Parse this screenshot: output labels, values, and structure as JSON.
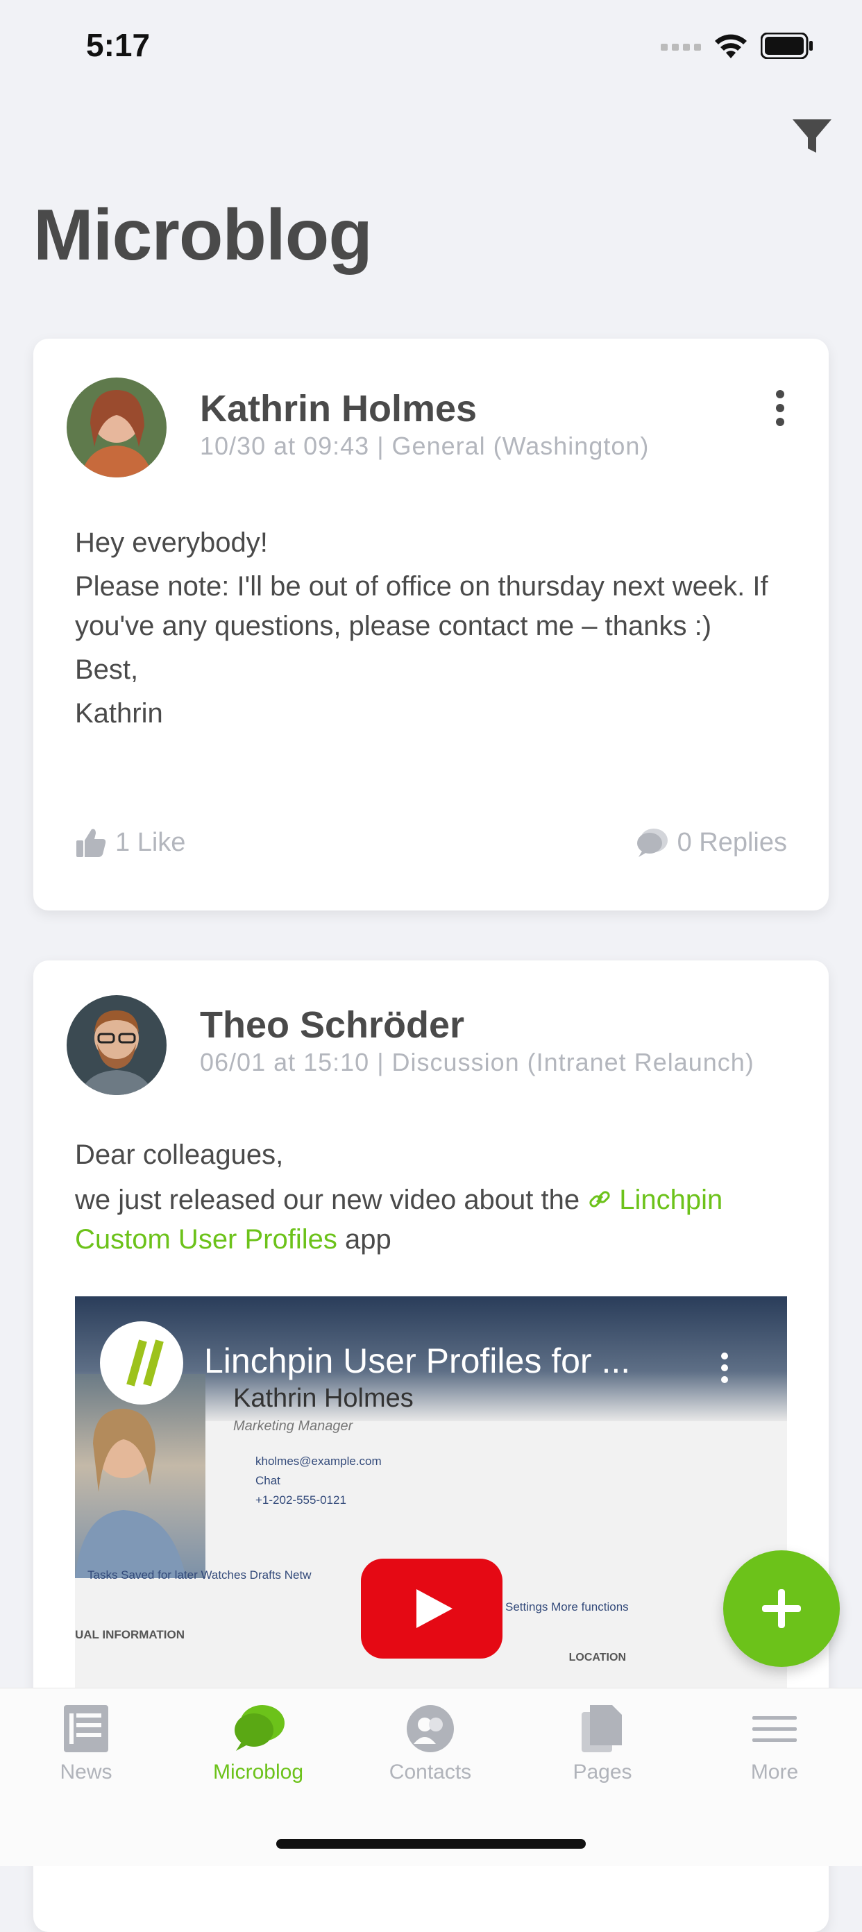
{
  "status_bar": {
    "time": "5:17"
  },
  "header": {
    "title": "Microblog"
  },
  "posts": [
    {
      "author": "Kathrin Holmes",
      "meta": "10/30 at 09:43 | General (Washington)",
      "lines": [
        "Hey everybody!",
        "Please note: I'll be out of office on thursday next week. If you've any questions, please contact me – thanks :)",
        "Best,",
        "Kathrin"
      ],
      "likes": "1 Like",
      "replies": "0 Replies"
    },
    {
      "author": "Theo Schröder",
      "meta": "06/01 at 15:10 | Discussion (Intranet Relaunch)",
      "line1": "Dear colleagues,",
      "line2_prefix": "we just released our new video about the ",
      "link_text": "Linchpin Custom User Profiles",
      "line2_suffix": " app",
      "video": {
        "title": "Linchpin User Profiles for ...",
        "name": "Kathrin Holmes",
        "subtitle": "Marketing Manager",
        "email": "kholmes@example.com",
        "chat": "Chat",
        "phone": "+1-202-555-0121",
        "tabs": "Tasks    Saved for later    Watches    Drafts    Netw",
        "tabs_right": "Settings    More functions",
        "section": "UAL INFORMATION",
        "location": "LOCATION"
      }
    }
  ],
  "tabbar": [
    {
      "label": "News",
      "active": false
    },
    {
      "label": "Microblog",
      "active": true
    },
    {
      "label": "Contacts",
      "active": false
    },
    {
      "label": "Pages",
      "active": false
    },
    {
      "label": "More",
      "active": false
    }
  ],
  "colors": {
    "accent": "#6cc21a",
    "muted": "#b3b6bd",
    "text": "#4a4a4a",
    "background": "#f1f2f6"
  }
}
